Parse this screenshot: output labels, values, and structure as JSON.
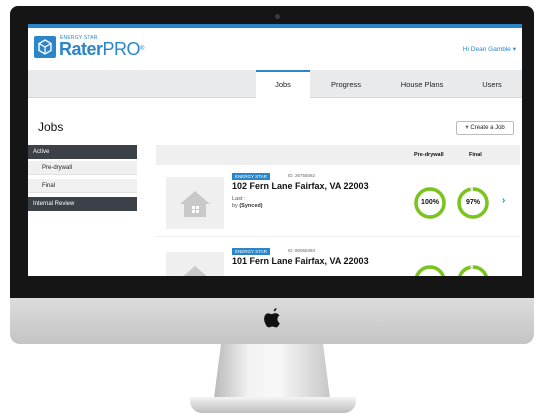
{
  "app": {
    "logo_small_text": "ENERGY STAR",
    "brand_main": "Rater",
    "brand_suffix": "PRO",
    "brand_tm": "®",
    "user_greeting": "Hi Dean Gamble",
    "user_caret": "▾"
  },
  "nav": {
    "tabs": [
      {
        "label": "Jobs",
        "active": true
      },
      {
        "label": "Progress",
        "active": false
      },
      {
        "label": "House Plans",
        "active": false
      },
      {
        "label": "Users",
        "active": false
      }
    ]
  },
  "page": {
    "title": "Jobs",
    "create_button": "Create a Job",
    "create_icon": "plus-icon"
  },
  "sidebar": {
    "sections": [
      {
        "label": "Active",
        "items": [
          "Pre-drywall",
          "Final"
        ]
      },
      {
        "label": "Internal Review",
        "items": []
      }
    ]
  },
  "list": {
    "columns": [
      "Pre-drywall",
      "Final"
    ],
    "jobs": [
      {
        "badge": "ENERGY STAR",
        "id": "ID: 26755062",
        "address": "102 Fern Lane Fairfax, VA 22003",
        "last_label": "Last :",
        "by_label": "by",
        "by_value": "(Synced)",
        "pre_drywall": "100%",
        "pre_drywall_value": 100,
        "final": "97%",
        "final_value": 97
      },
      {
        "badge": "ENERGY STAR",
        "id": "ID: 80055393",
        "address": "101 Fern Lane Fairfax, VA 22003",
        "pre_drywall_value": 100,
        "final_value": 97
      }
    ]
  },
  "colors": {
    "accent": "#2a86c8",
    "progress_ring": "#7ac41c",
    "sidebar_header": "#3c4048"
  }
}
